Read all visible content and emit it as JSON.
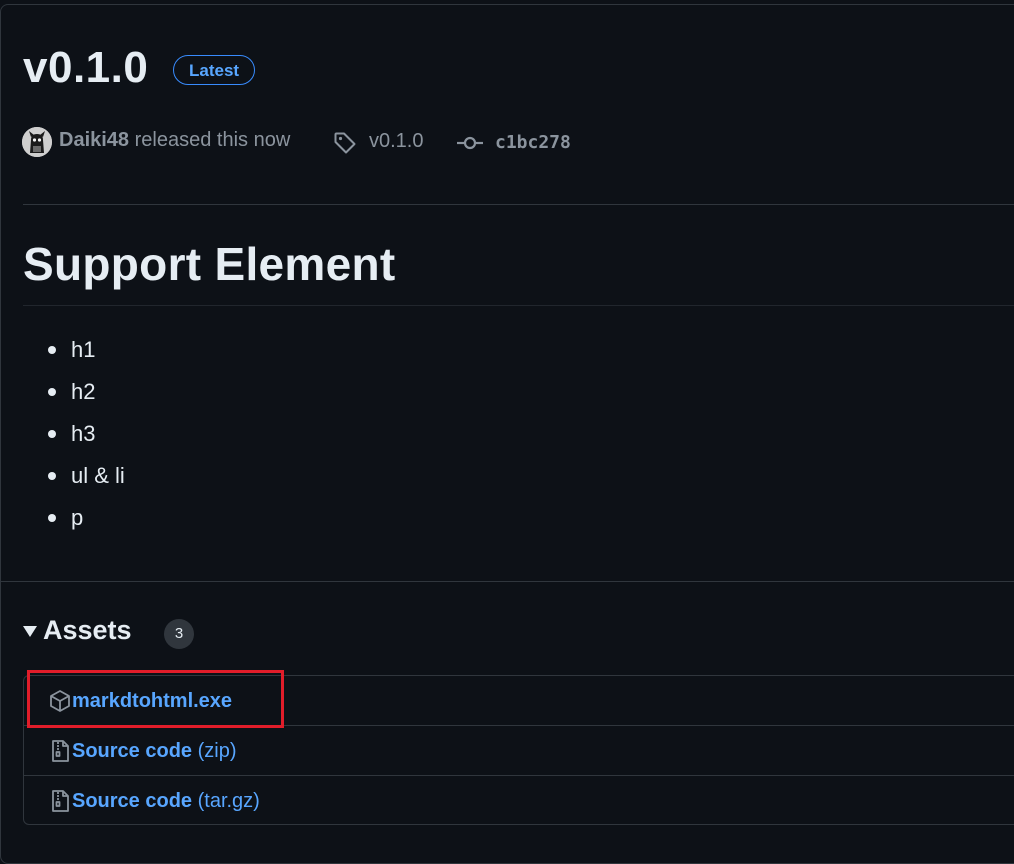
{
  "release": {
    "title": "v0.1.0",
    "badge": "Latest",
    "author": "Daiki48",
    "released_text": " released this now",
    "tag": "v0.1.0",
    "commit": "c1bc278"
  },
  "notes": {
    "heading": "Support Element",
    "items": [
      "h1",
      "h2",
      "h3",
      "ul & li",
      "p"
    ]
  },
  "assets": {
    "label": "Assets",
    "count": "3",
    "files": [
      {
        "name": "markdtohtml.exe",
        "suffix": "",
        "icon": "package-icon"
      },
      {
        "name": "Source code",
        "suffix": " (zip)",
        "icon": "file-zip-icon"
      },
      {
        "name": "Source code",
        "suffix": " (tar.gz)",
        "icon": "file-zip-icon"
      }
    ]
  },
  "colors": {
    "background": "#0d1117",
    "border": "#30363d",
    "link": "#58a6ff",
    "text": "#e6edf3",
    "muted": "#8b949e",
    "highlight": "#e11d2a"
  }
}
